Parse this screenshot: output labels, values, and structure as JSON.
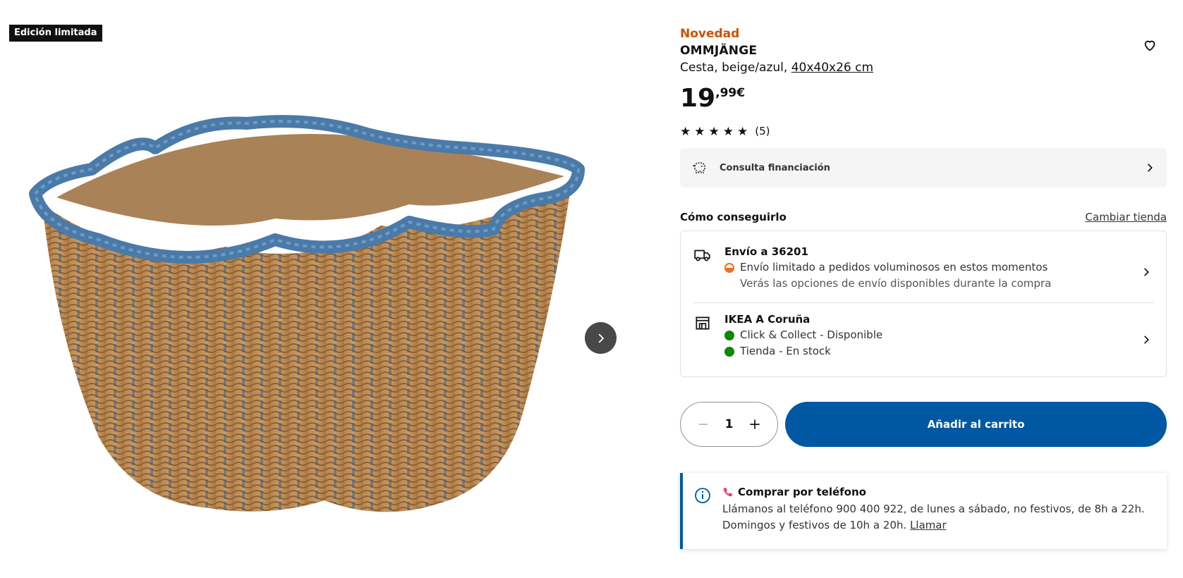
{
  "badge": "Edición limitada",
  "product": {
    "novelty": "Novedad",
    "name": "OMMJÄNGE",
    "description": "Cesta, beige/azul,",
    "size_link": "40x40x26 cm",
    "price_int": "19",
    "price_dec": ",99€",
    "rating_count": "(5)",
    "rating_stars": 5
  },
  "finance": {
    "label": "Consulta financiación"
  },
  "howto": {
    "title": "Cómo conseguirlo",
    "change_store": "Cambiar tienda",
    "delivery": {
      "title": "Envío a 36201",
      "line1": "Envío limitado a pedidos voluminosos en estos momentos",
      "line2": "Verás las opciones de envío disponibles durante la compra"
    },
    "store": {
      "title": "IKEA A Coruña",
      "line1": "Click & Collect - Disponible",
      "line2": "Tienda - En stock"
    }
  },
  "buy": {
    "quantity": "1",
    "add_to_cart": "Añadir al carrito"
  },
  "phone": {
    "title": "Comprar por teléfono",
    "text": "Llámanos al teléfono 900 400 922, de lunes a sábado, no festivos, de 8h a 22h. Domingos y festivos de 10h a 20h.",
    "link": "Llamar"
  },
  "colors": {
    "accent_blue": "#0058a3",
    "novelty_orange": "#cc5000",
    "stock_green": "#0a8a00",
    "warning_orange": "#f26a1b",
    "basket_blue": "#4a7aa8",
    "basket_wicker": "#b07f4a"
  },
  "icons": {
    "favorite": "heart-icon",
    "next": "chevron-right-icon",
    "finance": "piggy-bank-icon",
    "delivery": "truck-icon",
    "store": "store-icon",
    "info": "info-icon",
    "phone": "phone-icon",
    "minus": "minus-icon",
    "plus": "plus-icon"
  }
}
